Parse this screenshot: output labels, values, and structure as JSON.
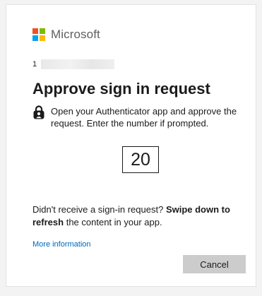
{
  "brand": {
    "name": "Microsoft",
    "logo_colors": [
      "#f25022",
      "#7fba00",
      "#00a4ef",
      "#ffb900"
    ]
  },
  "account": {
    "visible_prefix": "1"
  },
  "title": "Approve sign in request",
  "instruction": {
    "icon": "lock-person-icon",
    "text": "Open your Authenticator app and approve the request. Enter the number if prompted."
  },
  "number": "20",
  "hint": {
    "part1": "Didn't receive a sign-in request?",
    "bold": "Swipe down to refresh",
    "part2": "the content in your app."
  },
  "links": {
    "more_info": "More information"
  },
  "buttons": {
    "cancel": "Cancel"
  },
  "colors": {
    "link": "#0067b8",
    "button_bg": "#cccccc",
    "text": "#1b1b1b"
  }
}
